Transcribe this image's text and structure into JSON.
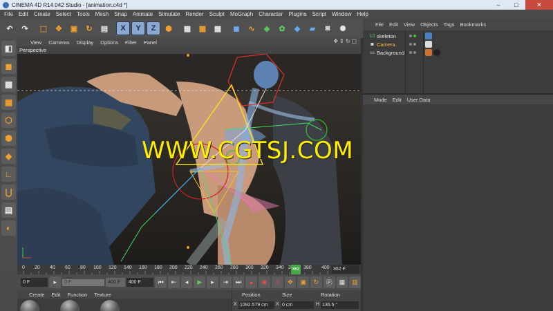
{
  "window": {
    "title": "CINEMA 4D R14.042 Studio - [animation.c4d *]"
  },
  "menubar": [
    "File",
    "Edit",
    "Create",
    "Select",
    "Tools",
    "Mesh",
    "Snap",
    "Animate",
    "Simulate",
    "Render",
    "Sculpt",
    "MoGraph",
    "Character",
    "Plugins",
    "Script",
    "Window",
    "Help"
  ],
  "toolbar": {
    "axis_x": "X",
    "axis_y": "Y",
    "axis_z": "Z"
  },
  "viewport": {
    "menu": [
      "View",
      "Cameras",
      "Display",
      "Options",
      "Filter",
      "Panel"
    ],
    "label": "Perspective",
    "watermark": "WWW.CGTSJ.COM"
  },
  "timeline": {
    "ticks": [
      "0",
      "20",
      "40",
      "60",
      "80",
      "100",
      "120",
      "140",
      "160",
      "180",
      "200",
      "220",
      "240",
      "260",
      "280",
      "300",
      "320",
      "340",
      "360",
      "380",
      "400"
    ],
    "current_frame": "362",
    "end_field": "362 F"
  },
  "transport": {
    "start_field": "0 F",
    "slider_min": "0 F",
    "slider_max": "400 F",
    "end_field": "400 F"
  },
  "material": {
    "menu": [
      "Create",
      "Edit",
      "Function",
      "Texture"
    ]
  },
  "coords": {
    "headers": {
      "position": "Position",
      "size": "Size",
      "rotation": "Rotation"
    },
    "row_x": {
      "axis": "X",
      "position": "1092.579 cm",
      "size_axis": "X",
      "size": "0 cm",
      "rot_axis": "H",
      "rotation": "136.5 °"
    }
  },
  "objects": {
    "menu": [
      "File",
      "Edit",
      "View",
      "Objects",
      "Tags",
      "Bookmarks"
    ],
    "items": [
      {
        "name": "skeleton",
        "color": "#e8e8e8"
      },
      {
        "name": "Camera",
        "color": "#f0c040"
      },
      {
        "name": "Background",
        "color": "#e8e8e8"
      }
    ]
  },
  "attributes": {
    "menu": [
      "Mode",
      "Edit",
      "User Data"
    ]
  },
  "icons": {
    "undo": "undo-icon",
    "redo": "redo-icon",
    "live-select": "live-select-icon",
    "move": "move-icon",
    "scale": "scale-icon",
    "rotate": "rotate-icon",
    "render": "render-icon",
    "cube": "cube-icon"
  }
}
